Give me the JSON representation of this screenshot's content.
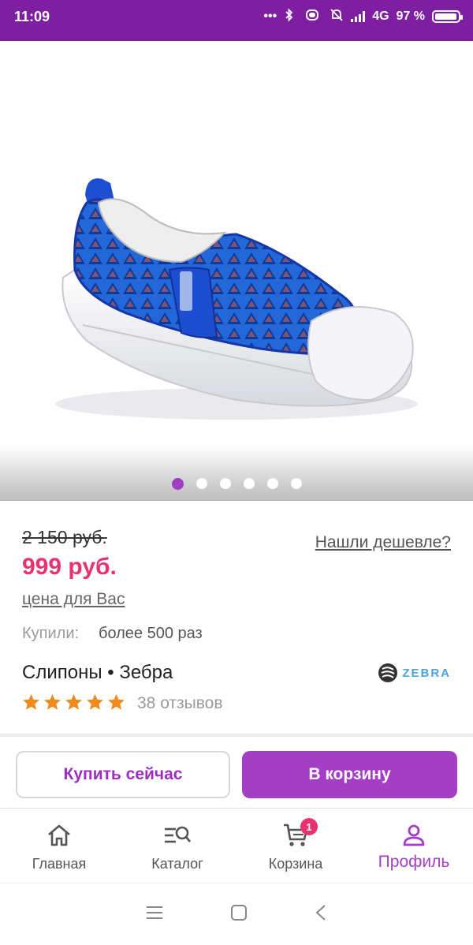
{
  "status_bar": {
    "time": "11:09",
    "network": "4G",
    "battery": "97 %",
    "battery_level": 0.97
  },
  "gallery": {
    "image_icon": "blue-slip-on-shoe-image",
    "dots_total": 6,
    "active_index": 0
  },
  "product": {
    "old_price": "2 150 руб.",
    "price": "999 руб.",
    "price_note": "цена для Вас",
    "cheaper_link": "Нашли дешевле?",
    "bought_label": "Купили:",
    "bought_value": "более 500 раз",
    "title": "Слипоны • Зебра",
    "brand_logo_text": "ZEBRA",
    "rating": 5,
    "reviews": "38 отзывов"
  },
  "actions": {
    "buy_now": "Купить сейчас",
    "add_to_cart": "В корзину"
  },
  "bottom_nav": {
    "items": [
      {
        "label": "Главная",
        "icon": "home-icon"
      },
      {
        "label": "Каталог",
        "icon": "catalog-search-icon"
      },
      {
        "label": "Корзина",
        "icon": "cart-icon",
        "badge": "1"
      },
      {
        "label": "Профиль",
        "icon": "profile-icon",
        "active": true
      }
    ]
  },
  "colors": {
    "brand_purple": "#7d1fa0",
    "accent_purple": "#a43fc5",
    "price_pink": "#e8336f",
    "star_orange": "#f08a1c"
  }
}
